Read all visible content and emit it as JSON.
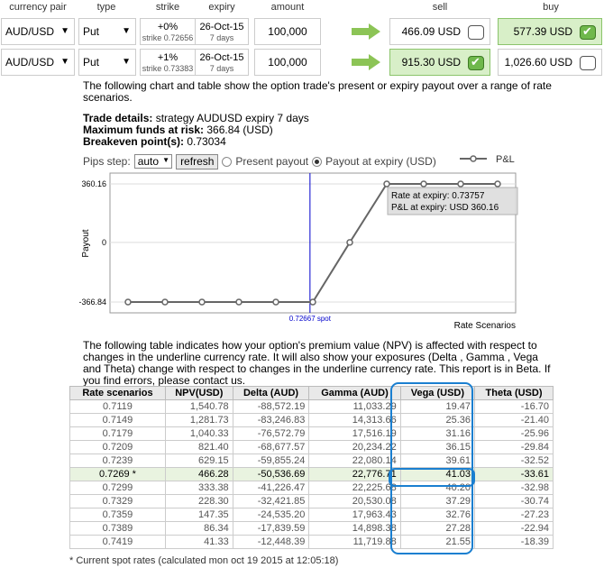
{
  "header": {
    "currency_pair": "currency pair",
    "type": "type",
    "strike": "strike",
    "expiry": "expiry",
    "amount": "amount",
    "sell": "sell",
    "buy": "buy"
  },
  "trades": [
    {
      "pair": "AUD/USD",
      "type": "Put",
      "strike_pct": "+0%",
      "strike_val": "strike 0.72656",
      "expiry_date": "26-Oct-15",
      "expiry_days": "7 days",
      "amount": "100,000",
      "sell": "466.09 USD",
      "sell_checked": false,
      "buy": "577.39 USD",
      "buy_checked": true
    },
    {
      "pair": "AUD/USD",
      "type": "Put",
      "strike_pct": "+1%",
      "strike_val": "strike 0.73383",
      "expiry_date": "26-Oct-15",
      "expiry_days": "7 days",
      "amount": "100,000",
      "sell": "915.30 USD",
      "sell_checked": true,
      "buy": "1,026.60 USD",
      "buy_checked": false
    }
  ],
  "intro": "The following chart and table show the option trade's present or expiry payout over a range of rate scenarios.",
  "details": {
    "trade_label": "Trade details:",
    "trade_value": " strategy AUDUSD expiry 7 days",
    "funds_label": "Maximum funds at risk:",
    "funds_value": " 366.84 (USD)",
    "breakeven_label": "Breakeven point(s):",
    "breakeven_value": " 0.73034"
  },
  "controls": {
    "pips_label": "Pips step:",
    "pips_value": "auto",
    "refresh": "refresh",
    "present": "Present payout",
    "expiry": "Payout at expiry (USD)",
    "selected": "expiry"
  },
  "chart_data": {
    "type": "line",
    "ylabel": "Payout",
    "xlabel": "Rate Scenarios",
    "legend": "P&L",
    "y_ticks": [
      "360.16",
      "0",
      "-366.84"
    ],
    "spot_label": "0.72667 spot",
    "spot_x": 0.72667,
    "x": [
      0.7119,
      0.7149,
      0.7179,
      0.7209,
      0.7239,
      0.7269,
      0.7299,
      0.7329,
      0.7359,
      0.7389,
      0.7419
    ],
    "values": [
      -366.84,
      -366.84,
      -366.84,
      -366.84,
      -366.84,
      -366.84,
      0,
      360.16,
      360.16,
      360.16,
      360.16
    ],
    "ylim": [
      -366.84,
      360.16
    ],
    "tooltip_line1": "Rate at expiry: 0.73757",
    "tooltip_line2": "P&L at expiry: USD 360.16",
    "color": "#666666",
    "spot_color": "#0000cc"
  },
  "table_intro": "The following table indicates how your option's premium value (NPV) is affected with respect to changes in the underline currency rate. It will also show your exposures (Delta , Gamma , Vega and Theta) change with respect to changes in the underline currency rate. This report is in Beta. If you find errors, please contact us.",
  "table": {
    "headers": [
      "Rate scenarios",
      "NPV(USD)",
      "Delta (AUD)",
      "Gamma (AUD)",
      "Vega (USD)",
      "Theta (USD)"
    ],
    "rows": [
      [
        "0.7119",
        "1,540.78",
        "-88,572.19",
        "11,033.29",
        "19.47",
        "-16.70"
      ],
      [
        "0.7149",
        "1,281.73",
        "-83,246.83",
        "14,313.66",
        "25.36",
        "-21.40"
      ],
      [
        "0.7179",
        "1,040.33",
        "-76,572.79",
        "17,516.19",
        "31.16",
        "-25.96"
      ],
      [
        "0.7209",
        "821.40",
        "-68,677.57",
        "20,234.22",
        "36.15",
        "-29.84"
      ],
      [
        "0.7239",
        "629.15",
        "-59,855.24",
        "22,080.14",
        "39.61",
        "-32.52"
      ],
      [
        "0.7269 *",
        "466.28",
        "-50,536.69",
        "22,776.71",
        "41.03",
        "-33.61"
      ],
      [
        "0.7299",
        "333.38",
        "-41,226.47",
        "22,225.68",
        "40.20",
        "-32.98"
      ],
      [
        "0.7329",
        "228.30",
        "-32,421.85",
        "20,530.08",
        "37.29",
        "-30.74"
      ],
      [
        "0.7359",
        "147.35",
        "-24,535.20",
        "17,963.43",
        "32.76",
        "-27.23"
      ],
      [
        "0.7389",
        "86.34",
        "-17,839.59",
        "14,898.38",
        "27.28",
        "-22.94"
      ],
      [
        "0.7419",
        "41.33",
        "-12,448.39",
        "11,719.88",
        "21.55",
        "-18.39"
      ]
    ],
    "spot_row": 5
  },
  "footnote": "* Current spot rates (calculated mon oct 19 2015 at 12:05:18)"
}
